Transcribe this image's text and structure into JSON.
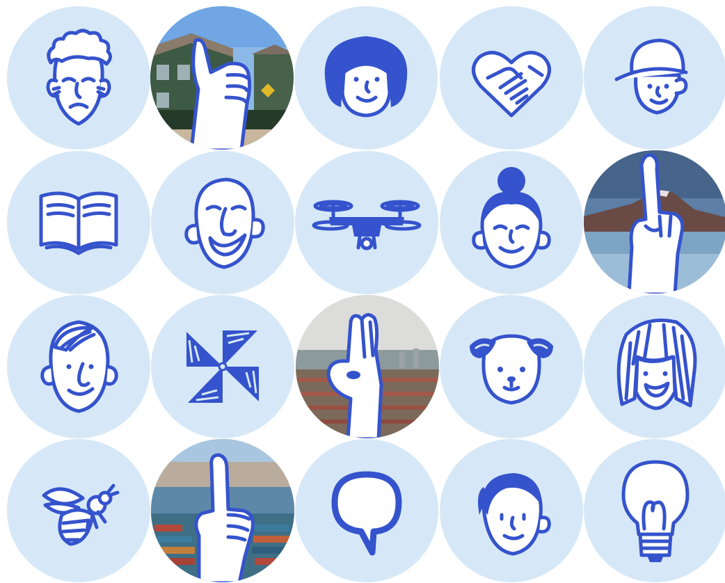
{
  "colors": {
    "circle_bg": "#d6e8f7",
    "ink": "#3553cc",
    "paper": "#ffffff"
  },
  "icons": [
    {
      "row": 1,
      "col": 1,
      "name": "curly-haired-man-face",
      "kind": "illustration"
    },
    {
      "row": 1,
      "col": 2,
      "name": "thumbs-up-hand-on-housing-photo",
      "kind": "photo"
    },
    {
      "row": 1,
      "col": 3,
      "name": "woman-with-bob-face",
      "kind": "illustration"
    },
    {
      "row": 1,
      "col": 4,
      "name": "heart-handshake",
      "kind": "illustration"
    },
    {
      "row": 1,
      "col": 5,
      "name": "boy-with-cap-face",
      "kind": "illustration"
    },
    {
      "row": 2,
      "col": 1,
      "name": "open-book",
      "kind": "illustration"
    },
    {
      "row": 2,
      "col": 2,
      "name": "bald-old-man-face",
      "kind": "illustration"
    },
    {
      "row": 2,
      "col": 3,
      "name": "drone",
      "kind": "illustration"
    },
    {
      "row": 2,
      "col": 4,
      "name": "woman-with-bun-face",
      "kind": "illustration"
    },
    {
      "row": 2,
      "col": 5,
      "name": "pointing-up-hand-on-volcano-lake-photo",
      "kind": "photo"
    },
    {
      "row": 3,
      "col": 1,
      "name": "man-with-side-part-face",
      "kind": "illustration"
    },
    {
      "row": 3,
      "col": 2,
      "name": "pinwheel",
      "kind": "illustration"
    },
    {
      "row": 3,
      "col": 3,
      "name": "ok-hand-on-town-photo",
      "kind": "photo"
    },
    {
      "row": 3,
      "col": 4,
      "name": "puppy-face",
      "kind": "illustration"
    },
    {
      "row": 3,
      "col": 5,
      "name": "woman-with-long-hair-face",
      "kind": "illustration"
    },
    {
      "row": 4,
      "col": 1,
      "name": "bee",
      "kind": "illustration"
    },
    {
      "row": 4,
      "col": 2,
      "name": "pointing-hand-on-port-city-photo",
      "kind": "photo"
    },
    {
      "row": 4,
      "col": 3,
      "name": "speech-bubble",
      "kind": "illustration"
    },
    {
      "row": 4,
      "col": 4,
      "name": "woman-with-ponytail-face",
      "kind": "illustration"
    },
    {
      "row": 4,
      "col": 5,
      "name": "light-bulb",
      "kind": "illustration"
    }
  ]
}
